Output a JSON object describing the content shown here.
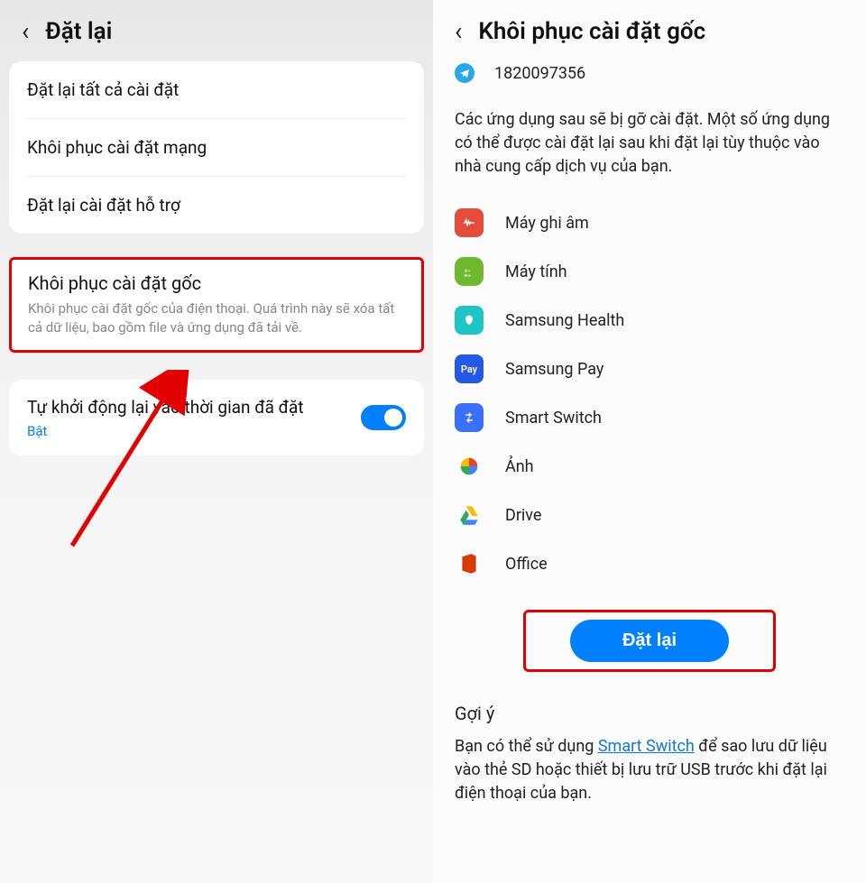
{
  "left": {
    "title": "Đặt lại",
    "options": [
      "Đặt lại tất cả cài đặt",
      "Khôi phục cài đặt mạng",
      "Đặt lại cài đặt hỗ trợ"
    ],
    "factory_reset": {
      "title": "Khôi phục cài đặt gốc",
      "desc": "Khôi phục cài đặt gốc của điện thoại. Quá trình này sẽ xóa tất cả dữ liệu, bao gồm file và ứng dụng đã tải về."
    },
    "auto_restart": {
      "title": "Tự khởi động lại vào thời gian đã đặt",
      "state": "Bật"
    }
  },
  "right": {
    "title": "Khôi phục cài đặt gốc",
    "telegram_id": "1820097356",
    "info": "Các ứng dụng sau sẽ bị gỡ cài đặt. Một số ứng dụng có thể được cài đặt lại sau khi đặt lại tùy thuộc vào nhà cung cấp dịch vụ của bạn.",
    "apps": [
      {
        "name": "Máy ghi âm"
      },
      {
        "name": "Máy tính"
      },
      {
        "name": "Samsung Health"
      },
      {
        "name": "Samsung Pay"
      },
      {
        "name": "Smart Switch"
      },
      {
        "name": "Ảnh"
      },
      {
        "name": "Drive"
      },
      {
        "name": "Office"
      }
    ],
    "reset_button": "Đặt lại",
    "hint_title": "Gợi ý",
    "hint_before": "Bạn có thể sử dụng ",
    "hint_link": "Smart Switch",
    "hint_after": " để sao lưu dữ liệu vào thẻ SD hoặc thiết bị lưu trữ USB trước khi đặt lại điện thoại của bạn."
  }
}
